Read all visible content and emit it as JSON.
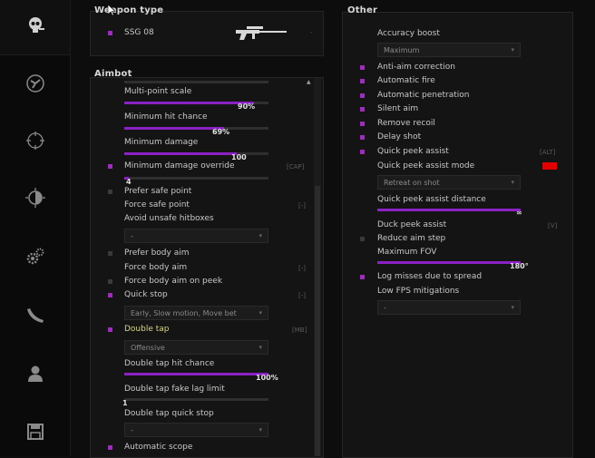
{
  "colors": {
    "accent": "#8b21c4",
    "checked": "#9a2fb8",
    "color_swatch": "#e00000"
  },
  "sidebar": {
    "icons": [
      "logo-skull-icon",
      "rage-crosshair-icon",
      "legit-crosshair-icon",
      "visuals-icon",
      "misc-gears-icon",
      "skins-knife-icon",
      "players-icon",
      "config-save-icon"
    ]
  },
  "weapon": {
    "section_title": "Weapon type",
    "selected": "SSG 08",
    "arrow": "-"
  },
  "aimbot": {
    "section_title": "Aimbot",
    "multipoint_label": "Multi-point scale",
    "multipoint_value": "90%",
    "multipoint_fraction": 0.9,
    "hitchance_label": "Minimum hit chance",
    "hitchance_value": "69%",
    "hitchance_fraction": 0.69,
    "min_damage_label": "Minimum damage",
    "min_damage_value": "100",
    "min_damage_fraction": 0.78,
    "override_label": "Minimum damage override",
    "override_key": "[CAP]",
    "override_value": "4",
    "override_fraction": 0.03,
    "prefer_safe_label": "Prefer safe point",
    "force_safe_label": "Force safe point",
    "force_safe_key": "[-]",
    "avoid_unsafe_label": "Avoid unsafe hitboxes",
    "avoid_unsafe_value": "-",
    "prefer_body_label": "Prefer body aim",
    "force_body_label": "Force body aim",
    "force_body_key": "[-]",
    "force_body_peek_label": "Force body aim on peek",
    "quick_stop_label": "Quick stop",
    "quick_stop_key": "[-]",
    "quick_stop_value": "Early, Slow motion, Move bet",
    "double_tap_label": "Double tap",
    "double_tap_key": "[MB]",
    "double_tap_mode": "Offensive",
    "dt_hitchance_label": "Double tap hit chance",
    "dt_hitchance_value": "100%",
    "dt_hitchance_fraction": 1.0,
    "dt_fakelag_label": "Double tap fake lag limit",
    "dt_fakelag_value": "1",
    "dt_fakelag_fraction": 0.0,
    "dt_quickstop_label": "Double tap quick stop",
    "dt_quickstop_value": "-",
    "auto_scope_label": "Automatic scope",
    "scroll_up": "▲"
  },
  "other": {
    "section_title": "Other",
    "accuracy_boost_label": "Accuracy boost",
    "accuracy_boost_value": "Maximum",
    "anti_aim_correction_label": "Anti-aim correction",
    "auto_fire_label": "Automatic fire",
    "auto_penetration_label": "Automatic penetration",
    "silent_aim_label": "Silent aim",
    "remove_recoil_label": "Remove recoil",
    "delay_shot_label": "Delay shot",
    "quick_peek_label": "Quick peek assist",
    "quick_peek_key": "[ALT]",
    "quick_peek_mode_label": "Quick peek assist mode",
    "quick_peek_mode_value": "Retreat on shot",
    "quick_peek_distance_label": "Quick peek assist distance",
    "quick_peek_distance_value": "∞",
    "quick_peek_distance_fraction": 1.0,
    "duck_peek_label": "Duck peek assist",
    "duck_peek_key": "[V]",
    "reduce_aim_step_label": "Reduce aim step",
    "max_fov_label": "Maximum FOV",
    "max_fov_value": "180°",
    "max_fov_fraction": 1.0,
    "log_misses_label": "Log misses due to spread",
    "low_fps_label": "Low FPS mitigations",
    "low_fps_value": "-"
  }
}
